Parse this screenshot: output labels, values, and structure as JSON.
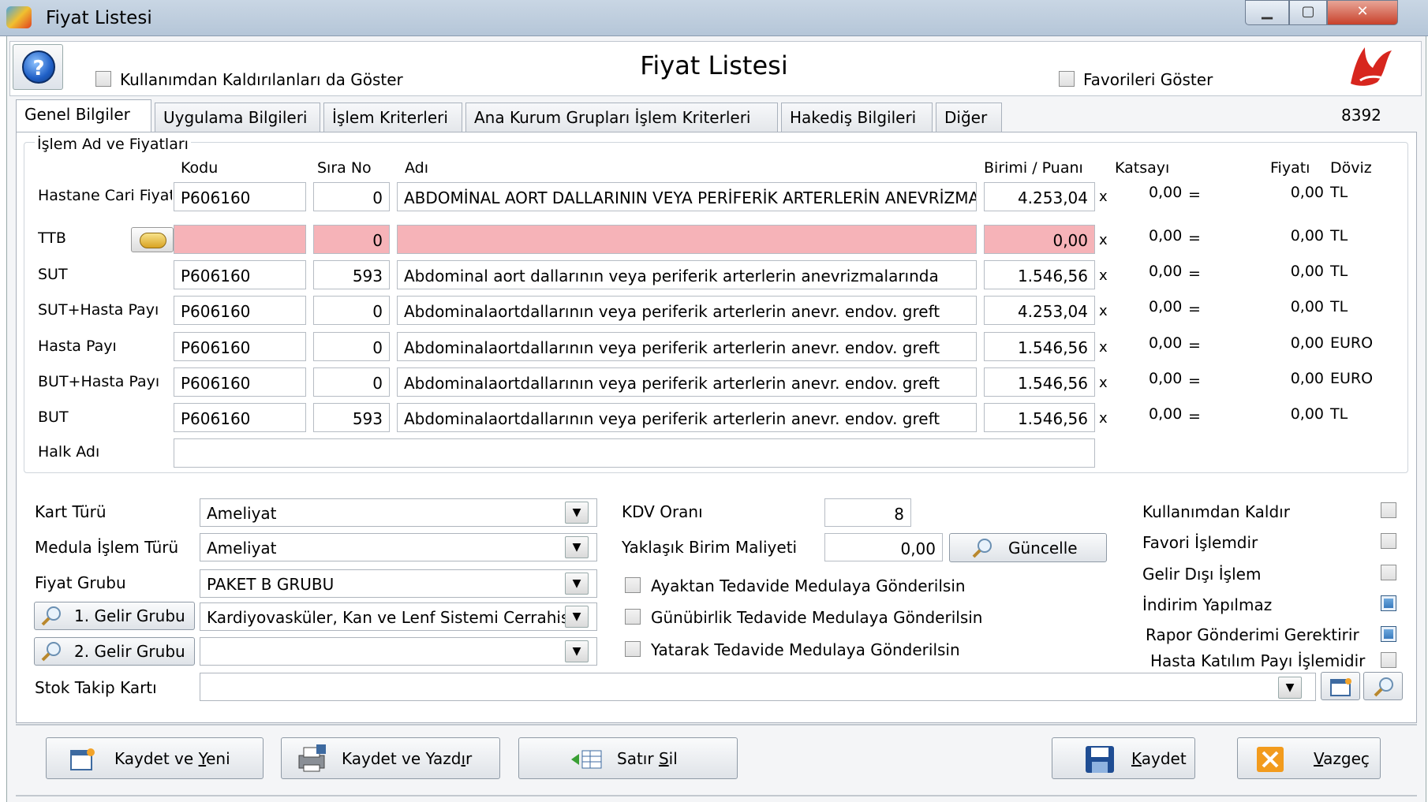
{
  "window": {
    "title": "Fiyat Listesi",
    "minimize": "▁",
    "maximize": "▢",
    "close": "✕"
  },
  "header": {
    "form_title": "Fiyat Listesi",
    "show_removed_label": "Kullanımdan Kaldırılanları da Göster",
    "show_favorites_label": "Favorileri Göster",
    "record_id": "8392"
  },
  "tabs": [
    "Genel Bilgiler",
    "Uygulama Bilgileri",
    "İşlem Kriterleri",
    "Ana Kurum Grupları İşlem Kriterleri",
    "Hakediş Bilgileri",
    "Diğer"
  ],
  "prices_group": {
    "title": "İşlem Ad ve Fiyatları",
    "columns": {
      "code": "Kodu",
      "order": "Sıra No",
      "name": "Adı",
      "unit": "Birimi / Puanı",
      "coef": "Katsayı",
      "price": "Fiyatı",
      "currency": "Döviz"
    },
    "rows": [
      {
        "label": "Hastane Cari Fiyatı",
        "code": "P606160",
        "order": "0",
        "name": "ABDOMİNAL AORT DALLARININ VEYA PERİFERİK ARTERLERİN ANEVRİZMALARINDA",
        "unit": "4.253,04",
        "x": "x",
        "coef": "0,00",
        "eq": "=",
        "price": "0,00",
        "currency": "TL"
      },
      {
        "label": "TTB",
        "code": "",
        "order": "0",
        "name": "",
        "unit": "0,00",
        "x": "x",
        "coef": "0,00",
        "eq": "=",
        "price": "0,00",
        "currency": "TL"
      },
      {
        "label": "SUT",
        "code": "P606160",
        "order": "593",
        "name": "Abdominal aort dallarının veya periferik arterlerin anevrizmalarında",
        "unit": "1.546,56",
        "x": "x",
        "coef": "0,00",
        "eq": "=",
        "price": "0,00",
        "currency": "TL"
      },
      {
        "label": "SUT+Hasta Payı",
        "code": "P606160",
        "order": "0",
        "name": "Abdominalaortdallarının veya periferik arterlerin anevr. endov. greft",
        "unit": "4.253,04",
        "x": "x",
        "coef": "0,00",
        "eq": "=",
        "price": "0,00",
        "currency": "TL"
      },
      {
        "label": "Hasta Payı",
        "code": "P606160",
        "order": "0",
        "name": "Abdominalaortdallarının veya periferik arterlerin anevr. endov. greft",
        "unit": "1.546,56",
        "x": "x",
        "coef": "0,00",
        "eq": "=",
        "price": "0,00",
        "currency": "EURO"
      },
      {
        "label": "BUT+Hasta Payı",
        "code": "P606160",
        "order": "0",
        "name": "Abdominalaortdallarının veya periferik arterlerin anevr. endov. greft",
        "unit": "1.546,56",
        "x": "x",
        "coef": "0,00",
        "eq": "=",
        "price": "0,00",
        "currency": "EURO"
      },
      {
        "label": "BUT",
        "code": "P606160",
        "order": "593",
        "name": "Abdominalaortdallarının veya periferik arterlerin anevr. endov. greft",
        "unit": "1.546,56",
        "x": "x",
        "coef": "0,00",
        "eq": "=",
        "price": "0,00",
        "currency": "TL"
      }
    ],
    "halk_adi_label": "Halk Adı",
    "halk_adi_value": ""
  },
  "details": {
    "kart_turu": {
      "label": "Kart Türü",
      "value": "Ameliyat"
    },
    "medula": {
      "label": "Medula İşlem Türü",
      "value": "Ameliyat"
    },
    "fiyat_grubu": {
      "label": "Fiyat Grubu",
      "value": "PAKET B GRUBU"
    },
    "gelir1": {
      "button": "1. Gelir Grubu",
      "value": "Kardiyovasküler, Kan ve Lenf Sistemi Cerrahisi"
    },
    "gelir2": {
      "button": "2. Gelir Grubu",
      "value": ""
    },
    "stok": {
      "label": "Stok Takip Kartı",
      "value": ""
    },
    "kdv": {
      "label": "KDV Oranı",
      "value": "8"
    },
    "maliyet": {
      "label": "Yaklaşık Birim  Maliyeti",
      "value": "0,00",
      "button": "Güncelle"
    },
    "ayaktan": "Ayaktan Tedavide Medulaya Gönderilsin",
    "gunubirlik": "Günübirlik Tedavide Medulaya Gönderilsin",
    "yatarak": "Yatarak Tedavide Medulaya Gönderilsin",
    "flags": [
      {
        "label": "Kullanımdan Kaldır",
        "checked": false
      },
      {
        "label": "Favori İşlemdir",
        "checked": false
      },
      {
        "label": "Gelir Dışı İşlem",
        "checked": false
      },
      {
        "label": "İndirim Yapılmaz",
        "checked": true
      },
      {
        "label": "Rapor Gönderimi Gerektirir",
        "checked": true
      },
      {
        "label": "Hasta Katılım Payı İşlemidir",
        "checked": false
      }
    ]
  },
  "footer": {
    "save_new": {
      "pre": "Kaydet ve ",
      "u": "Y",
      "post": "eni"
    },
    "save_print": {
      "pre": "Kaydet ve Yazd",
      "u": "ı",
      "post": "r"
    },
    "delete_row": {
      "pre": "Satır ",
      "u": "S",
      "post": "il"
    },
    "save": {
      "pre": "",
      "u": "K",
      "post": "aydet"
    },
    "cancel": {
      "pre": "",
      "u": "V",
      "post": "azgeç"
    }
  },
  "colors": {
    "required_field": "#f6b3b8",
    "checked": "#2d6fb5"
  }
}
